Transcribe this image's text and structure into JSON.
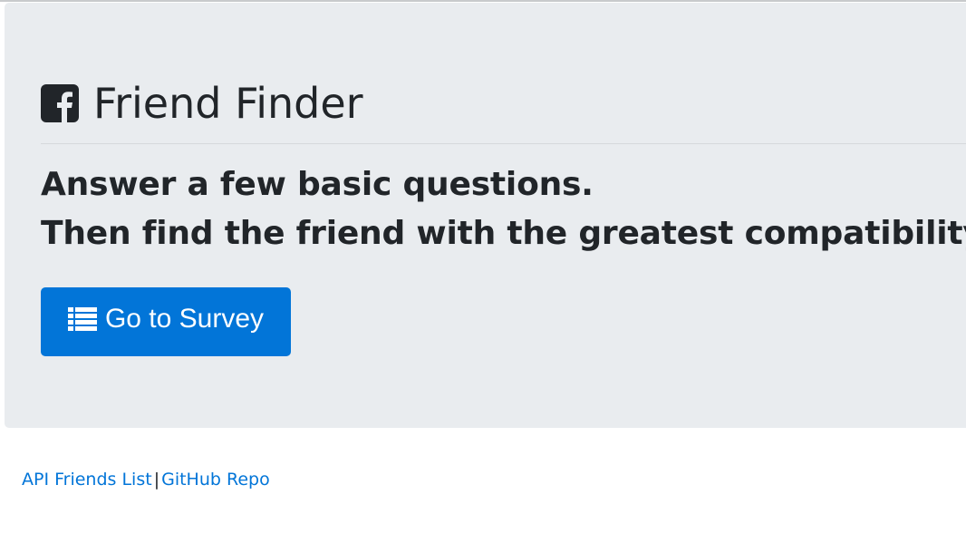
{
  "jumbotron": {
    "title": "Friend Finder",
    "title_icon": "facebook-square-icon",
    "lead_line_1": "Answer a few basic questions.",
    "lead_line_2": "Then find the friend with the greatest compatibility!",
    "survey_button": {
      "label": "Go to Survey",
      "icon": "list-icon"
    }
  },
  "footer": {
    "api_link": "API Friends List",
    "separator": "|",
    "github_link": "GitHub Repo"
  },
  "colors": {
    "jumbotron_bg": "#e9ecef",
    "button_primary": "#0275d8",
    "link": "#0275d8",
    "text": "#212529"
  }
}
